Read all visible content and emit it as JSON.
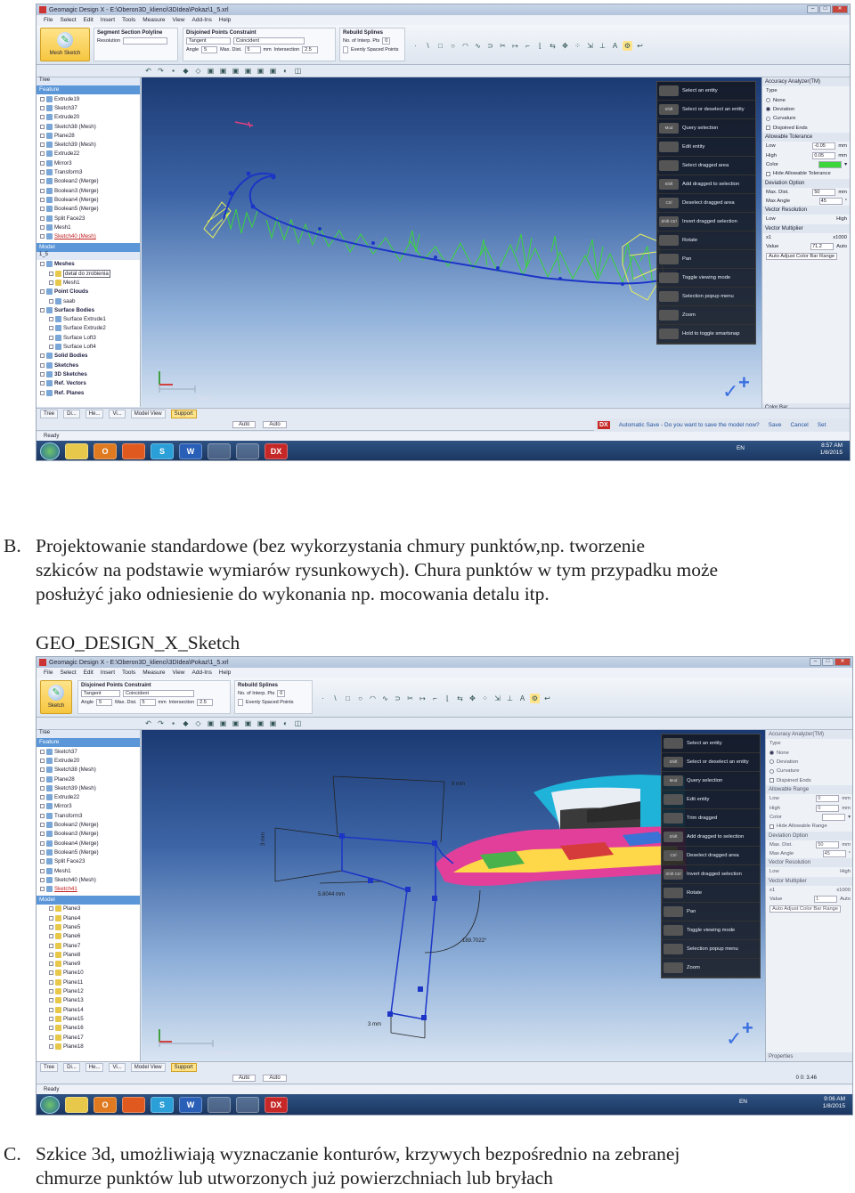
{
  "screenshot1": {
    "app_title": "Geomagic Design X - E:\\Oberon3D_klienci\\3DIdea\\Pokaz\\1_5.xrl",
    "menu": [
      "File",
      "Select",
      "Edit",
      "Insert",
      "Tools",
      "Measure",
      "View",
      "Add-Ins",
      "Help"
    ],
    "ribbon": {
      "big_tool": "Mesh Sketch",
      "segment_section": {
        "title": "Segment Section Polyline",
        "resolution_label": "Resolution"
      },
      "disjoined": {
        "title": "Disjoined Points Constraint",
        "tangent": "Tangent",
        "coincident": "Coincident",
        "angle_label": "Angle",
        "angle_value": "5",
        "max_dist_label": "Max. Dist.",
        "max_dist_value": "5",
        "max_dist_unit": "mm",
        "intersection_label": "Intersection",
        "intersection_value": "2.5",
        "intersection_unit": "mm"
      },
      "rebuild": {
        "title": "Rebuild Splines",
        "interp_label": "No. of Interp. Pts",
        "interp_value": "0",
        "evenly": "Evenly Spaced Points"
      }
    },
    "tree": {
      "title": "Tree",
      "feature_header": "Feature",
      "features": [
        "Extrude19",
        "Sketch37",
        "Extrude20",
        "Sketch38 (Mesh)",
        "Plane28",
        "Sketch39 (Mesh)",
        "Extrude22",
        "Mirror3",
        "Transform3",
        "Boolean2 (Merge)",
        "Boolean3 (Merge)",
        "Boolean4 (Merge)",
        "Boolean5 (Merge)",
        "Split Face23",
        "Mesh1",
        "Sketch40 (Mesh)"
      ],
      "model_header": "Model",
      "model_value": "1_5",
      "model_items": [
        "Meshes",
        "detal do zrobienia",
        "Mesh1",
        "Point Clouds",
        "saab",
        "Surface Bodies",
        "Surface Extrude1",
        "Surface Extrude2",
        "Surface Loft3",
        "Surface Loft4",
        "Solid Bodies",
        "Sketches",
        "3D Sketches",
        "Ref. Vectors",
        "Ref. Planes"
      ]
    },
    "viewport_scale": "5 mm",
    "nav_panel": [
      "Select an entity",
      "Select or deselect an entity",
      "Query selection",
      "Edit entity",
      "Select dragged area",
      "Add dragged to selection",
      "Deselect dragged area",
      "Invert dragged selection",
      "Rotate",
      "Pan",
      "Toggle viewing mode",
      "Selection popup menu",
      "Zoom",
      "Hold to toggle smartsnap"
    ],
    "nav_keys": [
      "",
      "Shift",
      "Mod",
      "",
      "",
      "Shift",
      "Ctrl",
      "Shift Ctrl",
      "",
      "",
      "",
      "",
      "",
      ""
    ],
    "props": {
      "title": "Accuracy Analyzer(TM)",
      "type_label": "Type",
      "types": [
        "None",
        "Deviation",
        "Curvature"
      ],
      "disjoined_ends": "Disjoined Ends",
      "allowable": "Allowable Tolerance",
      "low_label": "Low",
      "low_value": "-0.05",
      "high_label": "High",
      "high_value": "0.05",
      "unit": "mm",
      "color_label": "Color",
      "hide_allow": "Hide Allowable Tolerance",
      "deviation_option": "Deviation Option",
      "max_dist_label": "Max. Dist.",
      "max_dist_value": "50",
      "max_angle_label": "Max Angle",
      "max_angle_value": "45",
      "vector_res": "Vector Resolution",
      "low": "Low",
      "high": "High",
      "vector_mult": "Vector Multiplier",
      "x1": "x1",
      "x1000": "x1000",
      "value_label": "Value",
      "value_value": "71.2",
      "auto": "Auto",
      "auto_adjust": "Auto Adjust Color Bar Range",
      "color_bar": "Color Bar"
    },
    "bottom_tabs": [
      "Tree",
      "Di...",
      "He...",
      "Vi...",
      "Model View",
      "Support"
    ],
    "status": "Ready",
    "autosave": {
      "logo": "DX",
      "text": "Automatic Save - Do you want to save the model now?",
      "save": "Save",
      "cancel": "Cancel",
      "set": "Set"
    },
    "taskbar": {
      "apps": [
        "",
        "O",
        "",
        "S",
        "W",
        "",
        "",
        "DX"
      ],
      "lang": "EN",
      "time": "8:57 AM",
      "date": "1/8/2015"
    },
    "tiny_labels": {
      "auto1": "Auto",
      "auto2": "Auto"
    }
  },
  "caption_b": {
    "marker": "B.",
    "lines": [
      "Projektowanie standardowe (bez wykorzystania chmury punktów,np. tworzenie",
      "szkiców na podstawie wymiarów rysunkowych). Chura punktów w tym przypadku może",
      "posłużyć jako odniesienie do wykonania np. mocowania detalu itp."
    ],
    "label": "GEO_DESIGN_X_Sketch"
  },
  "screenshot2": {
    "app_title": "Geomagic Design X - E:\\Oberon3D_klienci\\3DIdea\\Pokaz\\1_5.xrl",
    "menu": [
      "File",
      "Select",
      "Edit",
      "Insert",
      "Tools",
      "Measure",
      "View",
      "Add-Ins",
      "Help"
    ],
    "ribbon": {
      "big_tool": "Sketch",
      "disjoined": {
        "title": "Disjoined Points Constraint",
        "tangent": "Tangent",
        "coincident": "Coincident",
        "angle_label": "Angle",
        "angle_value": "5",
        "max_dist_label": "Max. Dist.",
        "max_dist_value": "5",
        "max_dist_unit": "mm",
        "intersection_label": "Intersection",
        "intersection_value": "2.5",
        "intersection_unit": "mm"
      },
      "rebuild": {
        "title": "Rebuild Splines",
        "interp_label": "No. of Interp. Pts",
        "interp_value": "0",
        "evenly": "Evenly Spaced Points"
      }
    },
    "tree": {
      "title": "Tree",
      "feature_header": "Feature",
      "features": [
        "Sketch37",
        "Extrude20",
        "Sketch38 (Mesh)",
        "Plane28",
        "Sketch39 (Mesh)",
        "Extrude22",
        "Mirror3",
        "Transform3",
        "Boolean2 (Merge)",
        "Boolean3 (Merge)",
        "Boolean4 (Merge)",
        "Boolean5 (Merge)",
        "Split Face23",
        "Mesh1",
        "Sketch40 (Mesh)",
        "Sketch41"
      ],
      "model_header": "Model",
      "model_items": [
        "Plane3",
        "Plane4",
        "Plane5",
        "Plane6",
        "Plane7",
        "Plane8",
        "Plane9",
        "Plane10",
        "Plane11",
        "Plane12",
        "Plane13",
        "Plane14",
        "Plane15",
        "Plane16",
        "Plane17",
        "Plane18"
      ]
    },
    "dimensions": [
      "8 mm",
      "3 mm",
      "5.8044 mm",
      "189.7022°",
      "3 mm"
    ],
    "viewport_scale": "2.5 mm",
    "nav_panel": [
      "Select an entity",
      "Select or deselect an entity",
      "Query selection",
      "Edit entity",
      "Trim dragged",
      "Add dragged to selection",
      "Deselect dragged area",
      "Invert dragged selection",
      "Rotate",
      "Pan",
      "Toggle viewing mode",
      "Selection popup menu",
      "Zoom"
    ],
    "nav_keys": [
      "",
      "Shift",
      "Mod",
      "",
      "",
      "Shift",
      "Ctrl",
      "Shift Ctrl",
      "",
      "",
      "",
      "",
      ""
    ],
    "props": {
      "title": "Accuracy Analyzer(TM)",
      "type_label": "Type",
      "types": [
        "None",
        "Deviation",
        "Curvature"
      ],
      "disjoined_ends": "Disjoined Ends",
      "allowable": "Allowable Range",
      "low_label": "Low",
      "low_value": "0",
      "high_label": "High",
      "high_value": "0",
      "unit": "mm",
      "color_label": "Color",
      "hide_allow": "Hide Allowable Range",
      "deviation_option": "Deviation Option",
      "max_dist_label": "Max. Dist.",
      "max_dist_value": "50",
      "max_angle_label": "Max Angle",
      "max_angle_value": "45",
      "vector_res": "Vector Resolution",
      "low": "Low",
      "high": "High",
      "vector_mult": "Vector Multiplier",
      "x1": "x1",
      "x1000": "x1000",
      "value_label": "Value",
      "value_value": "1",
      "auto": "Auto",
      "auto_adjust": "Auto Adjust Color Bar Range",
      "properties": "Properties"
    },
    "bottom_tabs": [
      "Tree",
      "Di...",
      "He...",
      "Vi...",
      "Model View",
      "Support"
    ],
    "status": "Ready",
    "coords": "0 0: 3.46",
    "taskbar": {
      "apps": [
        "",
        "O",
        "",
        "S",
        "W",
        "",
        "",
        "DX"
      ],
      "lang": "EN",
      "time": "9:06 AM",
      "date": "1/8/2015"
    },
    "tiny_labels": {
      "auto1": "Auto",
      "auto2": "Auto"
    }
  },
  "caption_c": {
    "marker": "C.",
    "lines": [
      "Szkice 3d, umożliwiają wyznaczanie konturów, krzywych bezpośrednio na zebranej",
      "chmurze punktów lub utworzonych już powierzchniach lub bryłach"
    ]
  },
  "colors": {
    "accent": "#ffe48a",
    "tree_header": "#5a96d8",
    "taskbar": "#1a355e",
    "point_cloud": "#3ad63a",
    "sketch": "#1c35c7"
  }
}
